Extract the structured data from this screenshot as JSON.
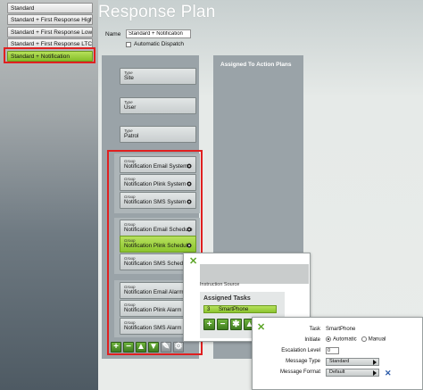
{
  "sidebar": {
    "plans": [
      {
        "label": "Standard",
        "selected": false
      },
      {
        "label": "Standard + First Response High",
        "selected": false
      },
      {
        "label": "Standard + First Response Low I",
        "selected": false
      },
      {
        "label": "Standard + First Response LTC",
        "selected": false
      },
      {
        "label": "Standard + Notification",
        "selected": true
      }
    ]
  },
  "main": {
    "title": "Response Plan",
    "name_label": "Name",
    "name_value": "Standard + Notification",
    "automatic_dispatch_label": "Automatic Dispatch",
    "automatic_dispatch_checked": false,
    "assigned_title": "Assigned To Action Plans",
    "type_tiles": [
      {
        "kind": "Type",
        "label": "Site"
      },
      {
        "kind": "Type",
        "label": "User"
      },
      {
        "kind": "Type",
        "label": "Patrol"
      }
    ],
    "group_tiles": [
      {
        "kind": "Group",
        "label": "Notification Email System",
        "highlight": false
      },
      {
        "kind": "Group",
        "label": "Notification Plink System",
        "highlight": false
      },
      {
        "kind": "Group",
        "label": "Notification SMS System",
        "highlight": false
      },
      {
        "kind": "Group",
        "label": "Notification Email Schedule",
        "highlight": false
      },
      {
        "kind": "Group",
        "label": "Notification Plink Schedule",
        "highlight": true
      },
      {
        "kind": "Group",
        "label": "Notification SMS Schedule",
        "highlight": false
      },
      {
        "kind": "Group",
        "label": "Notification Email Alarm",
        "highlight": false
      },
      {
        "kind": "Group",
        "label": "Notification Plink Alarm",
        "highlight": false
      },
      {
        "kind": "Group",
        "label": "Notification SMS Alarm",
        "highlight": false
      }
    ]
  },
  "dialog1": {
    "instruction_label": "Instruction Source",
    "assigned_tasks_title": "Assigned Tasks",
    "task": {
      "num": "3",
      "label": "SmartPhone"
    }
  },
  "dialog2": {
    "task_label": "Task",
    "task_value": "SmartPhone",
    "initiate_label": "Initiate",
    "initiate_automatic": "Automatic",
    "initiate_manual": "Manual",
    "initiate_selected": "Automatic",
    "escalation_label": "Escalation Level",
    "escalation_value": "0",
    "message_type_label": "Message Type",
    "message_type_value": "Standard",
    "message_format_label": "Message Format",
    "message_format_value": "Default"
  },
  "colors": {
    "selected_green": "#8cc52f",
    "highlight_red": "#e02020",
    "accent_blue": "#2a5aa8"
  }
}
